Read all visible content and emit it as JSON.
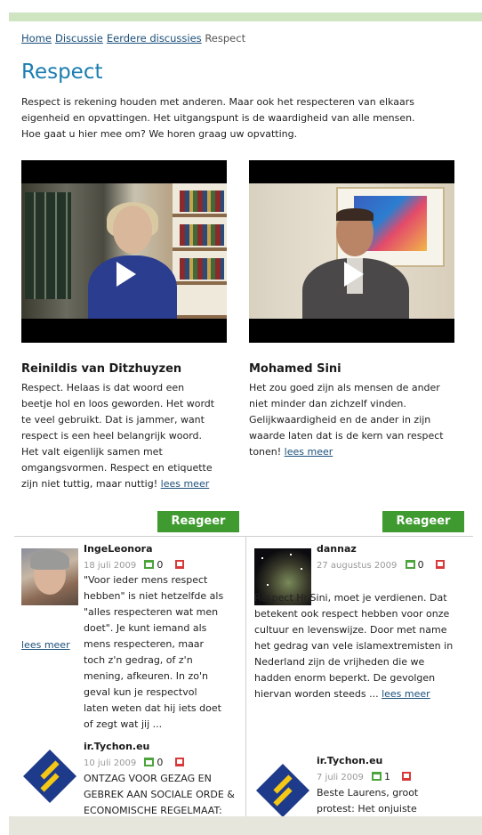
{
  "breadcrumb": {
    "home": "Home",
    "discussie": "Discussie",
    "eerdere": "Eerdere discussies",
    "current": "Respect"
  },
  "page": {
    "title": "Respect",
    "intro": "Respect is rekening houden met anderen. Maar ook het respecteren van elkaars eigenheid en opvattingen. Het uitgangspunt is de waardigheid van alle mensen. Hoe gaat u hier mee om? We horen graag uw opvatting."
  },
  "videos": [
    {
      "name": "Reinildis van Ditzhuyzen",
      "quote": "Respect. Helaas is dat woord een beetje hol en loos geworden. Het wordt te veel gebruikt. Dat is jammer, want respect is een heel belangrijk woord. Het valt eigenlijk samen met omgangsvormen. Respect en etiquette zijn niet tuttig, maar nuttig!",
      "more": "lees meer",
      "react": "Reageer"
    },
    {
      "name": "Mohamed Sini",
      "quote": "Het zou goed zijn als mensen de ander niet minder dan zichzelf vinden. Gelijkwaardigheid en de ander in zijn waarde laten dat is de kern van respect tonen!",
      "more": "lees meer",
      "react": "Reageer"
    }
  ],
  "comments_left": [
    {
      "author": "IngeLeonora",
      "date": "18 juli 2009",
      "likes": "0",
      "text": "\"Voor ieder mens respect hebben\" is niet hetzelfde als \"alles respecteren wat men doet\". Je kunt iemand als mens respecteren, maar toch z'n gedrag, of z'n mening, afkeuren. In zo'n geval kun je respectvol laten weten dat hij iets doet of zegt wat jij ...",
      "more": "lees meer"
    },
    {
      "author": "ir.Tychon.eu",
      "date": "10 juli 2009",
      "likes": "0",
      "text": "ONTZAG VOOR GEZAG EN GEBREK AAN SOCIALE ORDE & ECONOMISCHE REGELMAAT:"
    }
  ],
  "comments_right": [
    {
      "author": "dannaz",
      "date": "27 augustus 2009",
      "likes": "0",
      "text": "Respect Hr.Sini, moet je verdienen. Dat betekent ook respect hebben voor onze cultuur en levenswijze. Door met name het gedrag van vele islamextremisten in Nederland zijn de vrijheden die we hadden enorm beperkt. De gevolgen hiervan worden steeds ...",
      "more": "lees meer"
    },
    {
      "author": "ir.Tychon.eu",
      "date": "7 juli 2009",
      "likes": "1",
      "text": "Beste Laurens, groot protest: Het onjuiste"
    }
  ],
  "colors": {
    "title": "#1a7db0",
    "button": "#3f9a2f",
    "link": "#1b4f7a",
    "top_bar": "#cfe5c2"
  }
}
